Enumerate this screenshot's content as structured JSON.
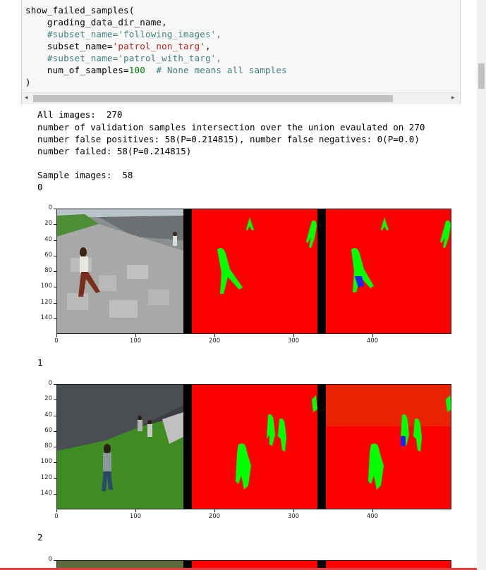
{
  "code": {
    "lines": [
      [
        {
          "t": "show_failed_samples("
        }
      ],
      [
        {
          "t": "    grading_data_dir_name,"
        }
      ],
      [
        {
          "t": "    #subset_name='following_images',",
          "c": "com"
        }
      ],
      [
        {
          "t": "    subset_name="
        },
        {
          "t": "'patrol_non_targ'",
          "c": "str"
        },
        {
          "t": ","
        }
      ],
      [
        {
          "t": "    #subset_name='patrol_with_targ',",
          "c": "com"
        }
      ],
      [
        {
          "t": "    num_of_samples="
        },
        {
          "t": "100",
          "c": "num"
        },
        {
          "t": "  "
        },
        {
          "t": "# None means all samples",
          "c": "com"
        }
      ],
      [
        {
          "t": ")"
        }
      ]
    ]
  },
  "output": {
    "all_images": "All images:  270",
    "iou_line": "number of validation samples intersection over the union evaulated on 270",
    "false_line": "number false positives: 58(P=0.214815), number false negatives: 0(P=0.0)",
    "failed_line": "number failed: 58(P=0.214815)",
    "sample_images": "Sample images:  58",
    "sample_0": "0",
    "sample_1": "1",
    "sample_2": "2"
  },
  "axis": {
    "y_ticks": [
      "0",
      "20",
      "40",
      "60",
      "80",
      "100",
      "120",
      "140"
    ],
    "x_ticks": [
      "0",
      "100",
      "200",
      "300",
      "400"
    ]
  },
  "colors": {
    "mask_red": "#ff0000",
    "mask_green": "#00ff00",
    "mask_blue": "#2222ee",
    "separator": "#000000"
  }
}
